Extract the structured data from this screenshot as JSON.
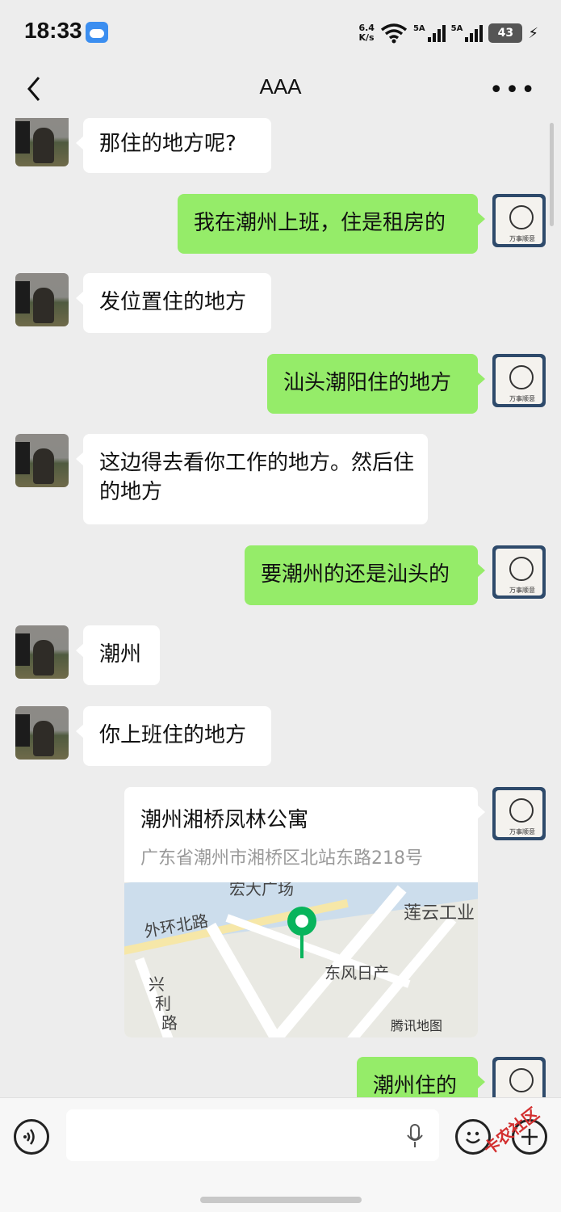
{
  "status_bar": {
    "time": "18:33",
    "net_speed_value": "6.4",
    "net_speed_unit": "K/s",
    "sim1_label": "5A",
    "sim2_label": "5A",
    "battery": "43"
  },
  "header": {
    "title": "AAA"
  },
  "messages": [
    {
      "side": "left",
      "text": "那住的地方呢?"
    },
    {
      "side": "right",
      "text": "我在潮州上班，住是租房的"
    },
    {
      "side": "left",
      "text": "发位置住的地方"
    },
    {
      "side": "right",
      "text": "汕头潮阳住的地方"
    },
    {
      "side": "left",
      "text": "这边得去看你工作的地方。然后住的地方"
    },
    {
      "side": "right",
      "text": "要潮州的还是汕头的"
    },
    {
      "side": "left",
      "text": "潮州"
    },
    {
      "side": "left",
      "text": "你上班住的地方"
    },
    {
      "side": "right",
      "text": "潮州住的"
    }
  ],
  "location_card": {
    "name": "潮州湘桥凤林公寓",
    "address": "广东省潮州市湘桥区北站东路218号",
    "map_labels": [
      "宏大广场",
      "莲云工业",
      "外环北路",
      "东风日产",
      "兴",
      "利",
      "路",
      "腾讯地图"
    ]
  },
  "avatar_right_caption": "万事顺意",
  "watermark": "卡农社区",
  "colors": {
    "sent_bubble": "#95ec69",
    "received_bubble": "#ffffff",
    "background": "#ededed",
    "map_pin": "#08b45c"
  }
}
